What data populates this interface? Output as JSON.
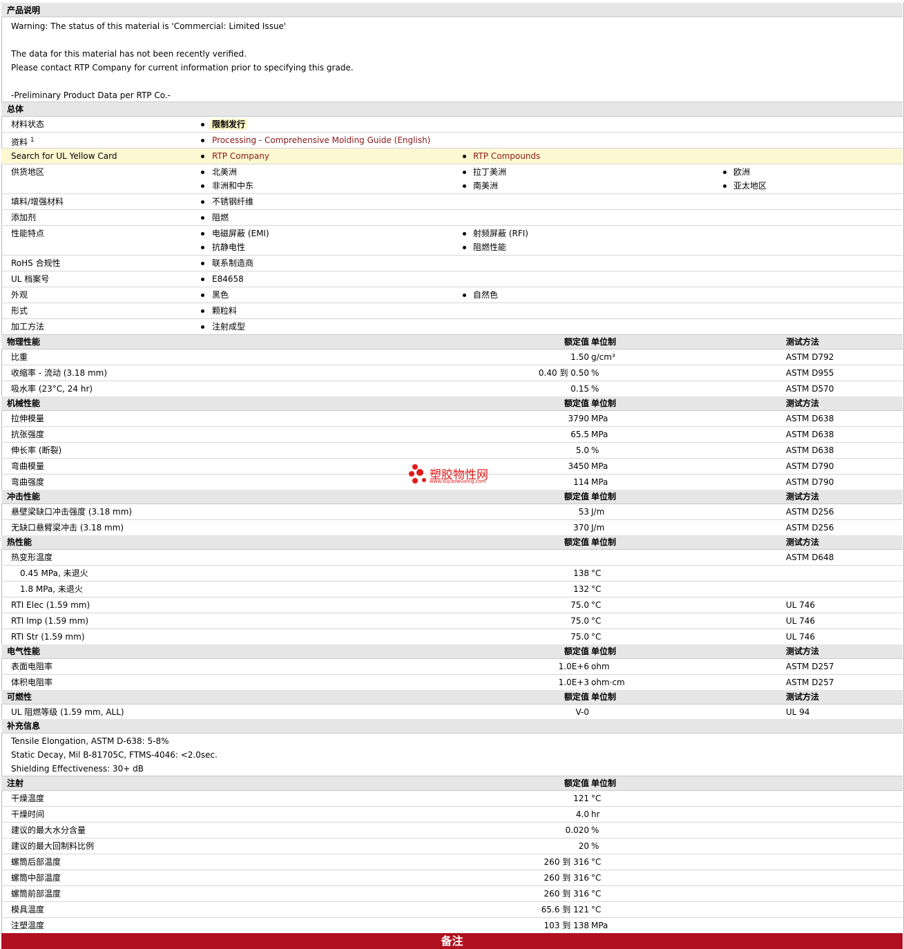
{
  "product_description": {
    "header": "产品说明",
    "lines": [
      "Warning: The status of this material is 'Commercial: Limited Issue'",
      "The data for this material has not been recently verified.",
      "Please contact RTP Company for current information prior to specifying this grade.",
      "-Preliminary Product Data per RTP Co.-"
    ]
  },
  "general": {
    "header": "总体",
    "material_status": {
      "label": "材料状态",
      "value": "限制发行"
    },
    "literature": {
      "label": "资料",
      "sup": "1",
      "value": "Processing - Comprehensive Molding Guide (English)"
    },
    "ul_card": {
      "label": "Search for UL Yellow Card",
      "values": [
        "RTP Company",
        "RTP Compounds"
      ]
    },
    "availability": {
      "label": "供货地区",
      "values": [
        "北美洲",
        "拉丁美洲",
        "欧洲",
        "非洲和中东",
        "南美洲",
        "亚太地区"
      ]
    },
    "filler": {
      "label": "填料/增强材料",
      "value": "不锈钢纤维"
    },
    "additive": {
      "label": "添加剂",
      "value": "阻燃"
    },
    "features": {
      "label": "性能特点",
      "values": [
        "电磁屏蔽 (EMI)",
        "射频屏蔽 (RFI)",
        "抗静电性",
        "阻燃性能"
      ]
    },
    "rohs": {
      "label": "RoHS 合规性",
      "value": "联系制造商"
    },
    "ul_file": {
      "label": "UL 档案号",
      "value": "E84658"
    },
    "appearance": {
      "label": "外观",
      "values": [
        "黑色",
        "自然色"
      ]
    },
    "form": {
      "label": "形式",
      "value": "颗粒料"
    },
    "processing": {
      "label": "加工方法",
      "value": "注射成型"
    }
  },
  "col_headers": {
    "nominal": "额定值",
    "unit": "单位制",
    "method": "测试方法"
  },
  "physical": {
    "header": "物理性能",
    "rows": [
      {
        "label": "比重",
        "value": "1.50",
        "unit": "g/cm³",
        "method": "ASTM D792"
      },
      {
        "label": "收缩率 - 流动 (3.18 mm)",
        "value": "0.40 到  0.50",
        "unit": "%",
        "method": "ASTM D955"
      },
      {
        "label": "吸水率 (23°C, 24 hr)",
        "value": "0.15",
        "unit": "%",
        "method": "ASTM D570"
      }
    ]
  },
  "mechanical": {
    "header": "机械性能",
    "rows": [
      {
        "label": "拉伸模量",
        "value": "3790",
        "unit": "MPa",
        "method": "ASTM D638"
      },
      {
        "label": "抗张强度",
        "value": "65.5",
        "unit": "MPa",
        "method": "ASTM D638"
      },
      {
        "label": "伸长率 (断裂)",
        "value": "5.0",
        "unit": "%",
        "method": "ASTM D638"
      },
      {
        "label": "弯曲模量",
        "value": "3450",
        "unit": "MPa",
        "method": "ASTM D790"
      },
      {
        "label": "弯曲强度",
        "value": "114",
        "unit": "MPa",
        "method": "ASTM D790"
      }
    ]
  },
  "impact": {
    "header": "冲击性能",
    "rows": [
      {
        "label": "悬壁梁缺口冲击强度 (3.18 mm)",
        "value": "53",
        "unit": "J/m",
        "method": "ASTM D256"
      },
      {
        "label": "无缺口悬臂梁冲击 (3.18 mm)",
        "value": "370",
        "unit": "J/m",
        "method": "ASTM D256"
      }
    ]
  },
  "thermal": {
    "header": "热性能",
    "rows": [
      {
        "label": "热变形温度",
        "value": "",
        "unit": "",
        "method": "ASTM D648"
      },
      {
        "label": "0.45 MPa, 未退火",
        "value": "138",
        "unit": "°C",
        "method": ""
      },
      {
        "label": "1.8 MPa, 未退火",
        "value": "132",
        "unit": "°C",
        "method": ""
      },
      {
        "label": "RTI Elec (1.59 mm)",
        "value": "75.0",
        "unit": "°C",
        "method": "UL 746"
      },
      {
        "label": "RTI Imp (1.59 mm)",
        "value": "75.0",
        "unit": "°C",
        "method": "UL 746"
      },
      {
        "label": "RTI Str (1.59 mm)",
        "value": "75.0",
        "unit": "°C",
        "method": "UL 746"
      }
    ]
  },
  "electrical": {
    "header": "电气性能",
    "rows": [
      {
        "label": "表面电阻率",
        "value": "1.0E+6",
        "unit": "ohm",
        "method": "ASTM D257"
      },
      {
        "label": "体积电阻率",
        "value": "1.0E+3",
        "unit": "ohm·cm",
        "method": "ASTM D257"
      }
    ]
  },
  "flammability": {
    "header": "可燃性",
    "rows": [
      {
        "label": "UL 阻燃等级 (1.59 mm, ALL)",
        "value": "V-0",
        "unit": "",
        "method": "UL 94"
      }
    ]
  },
  "supplemental": {
    "header": "补充信息",
    "lines": [
      "Tensile Elongation, ASTM D-638: 5-8%",
      "Static Decay, Mil B-81705C, FTMS-4046: <2.0sec.",
      "Shielding Effectiveness: 30+ dB"
    ]
  },
  "injection": {
    "header": "注射",
    "rows": [
      {
        "label": "干燥温度",
        "value": "121",
        "unit": "°C"
      },
      {
        "label": "干燥时间",
        "value": "4.0",
        "unit": "hr"
      },
      {
        "label": "建议的最大水分含量",
        "value": "0.020",
        "unit": "%"
      },
      {
        "label": "建议的最大回制料比例",
        "value": "20",
        "unit": "%"
      },
      {
        "label": "螺筒后部温度",
        "value": "260 到  316",
        "unit": "°C"
      },
      {
        "label": "螺筒中部温度",
        "value": "260 到  316",
        "unit": "°C"
      },
      {
        "label": "螺筒前部温度",
        "value": "260 到  316",
        "unit": "°C"
      },
      {
        "label": "模具温度",
        "value": "65.6 到  121",
        "unit": "°C"
      },
      {
        "label": "注塑温度",
        "value": "103 到  138",
        "unit": "MPa"
      }
    ]
  },
  "notes_bar": "备注",
  "watermark": {
    "name": "塑胶物性网",
    "url": "www.sujiaowuxing.com"
  },
  "colors": {
    "header_bg": "#e6e6e6",
    "link": "#8a1616",
    "highlight": "#fef8d2",
    "notes_bar": "#b0101f"
  }
}
